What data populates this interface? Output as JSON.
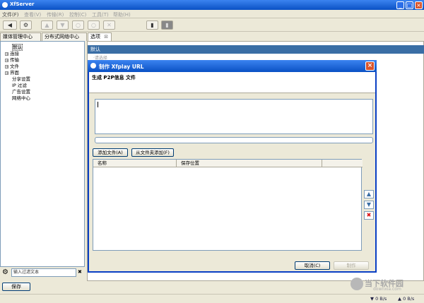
{
  "window": {
    "title": "XfServer",
    "buttons": [
      "_",
      "□",
      "×"
    ]
  },
  "menu": [
    {
      "label": "文件(F)",
      "active": true
    },
    {
      "label": "查看(V)",
      "active": false
    },
    {
      "label": "传输(R)",
      "active": false
    },
    {
      "label": "控制(C)",
      "active": false
    },
    {
      "label": "工具(T)",
      "active": false
    },
    {
      "label": "帮助(H)",
      "active": false
    }
  ],
  "toolbar": {
    "glyphs": [
      "◀",
      "⚙",
      "▲",
      "▼",
      "○",
      "○",
      "✕",
      "▮",
      "▮"
    ]
  },
  "tabs": [
    {
      "label": "媒体管理中心"
    },
    {
      "label": "分布式网络中心"
    },
    {
      "label": "选项",
      "close": "⊠"
    }
  ],
  "tree": [
    {
      "label": "默认",
      "expandable": false,
      "selected": true
    },
    {
      "label": "连接",
      "expandable": true,
      "selected": false
    },
    {
      "label": "传输",
      "expandable": true,
      "selected": false
    },
    {
      "label": "文件",
      "expandable": true,
      "selected": false
    },
    {
      "label": "界面",
      "expandable": true,
      "selected": false
    },
    {
      "label": "分享设置",
      "expandable": false,
      "selected": false
    },
    {
      "label": "IP 过滤",
      "expandable": false,
      "selected": false
    },
    {
      "label": "广告设置",
      "expandable": false,
      "selected": false
    },
    {
      "label": "网络中心",
      "expandable": false,
      "selected": false
    }
  ],
  "filter": {
    "placeholder": "输入过滤文本",
    "clear": "✖"
  },
  "save_label": "保存",
  "right": {
    "header": "默认",
    "subtext": "·请选择"
  },
  "dialog": {
    "title": "制作 Xfplay URL",
    "heading": "生成 P2P信息 文件",
    "add_file": "添加文件(A)",
    "add_folder": "从文件夹添加(F)",
    "columns": [
      "名称",
      "保存位置"
    ],
    "cancel": "取消(C)",
    "make": "制作",
    "close": "×",
    "side_buttons": [
      "▲",
      "▼",
      "✖"
    ]
  },
  "status": {
    "down": "▼ 0 B/s",
    "up": "▲ 0 B/s"
  },
  "watermark": {
    "title": "当下软件园",
    "sub": "downxia.com"
  }
}
